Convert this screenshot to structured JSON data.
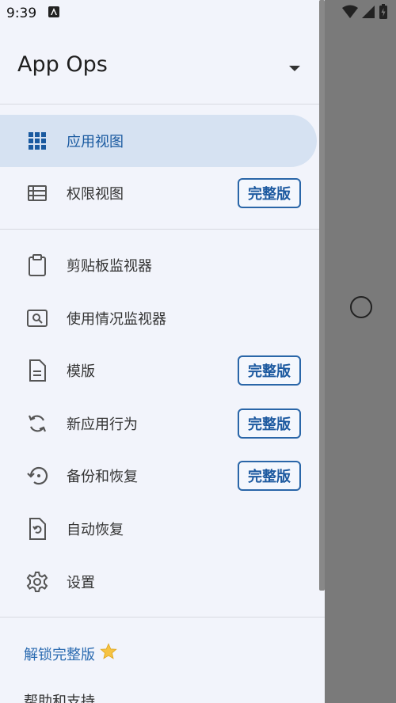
{
  "status": {
    "time": "9:39"
  },
  "app": {
    "title": "App Ops"
  },
  "nav": {
    "app_view": "应用视图",
    "permission_view": "权限视图",
    "clipboard_monitor": "剪贴板监视器",
    "usage_monitor": "使用情况监视器",
    "templates": "模版",
    "new_app_behavior": "新应用行为",
    "backup_restore": "备份和恢复",
    "auto_restore": "自动恢复",
    "settings": "设置"
  },
  "badges": {
    "full_version": "完整版"
  },
  "footer": {
    "unlock_full": "解锁完整版",
    "help_support": "帮助和支持"
  },
  "colors": {
    "accent": "#2a66a8",
    "active_bg": "#d6e2f2",
    "drawer_bg": "#f2f4fb"
  }
}
